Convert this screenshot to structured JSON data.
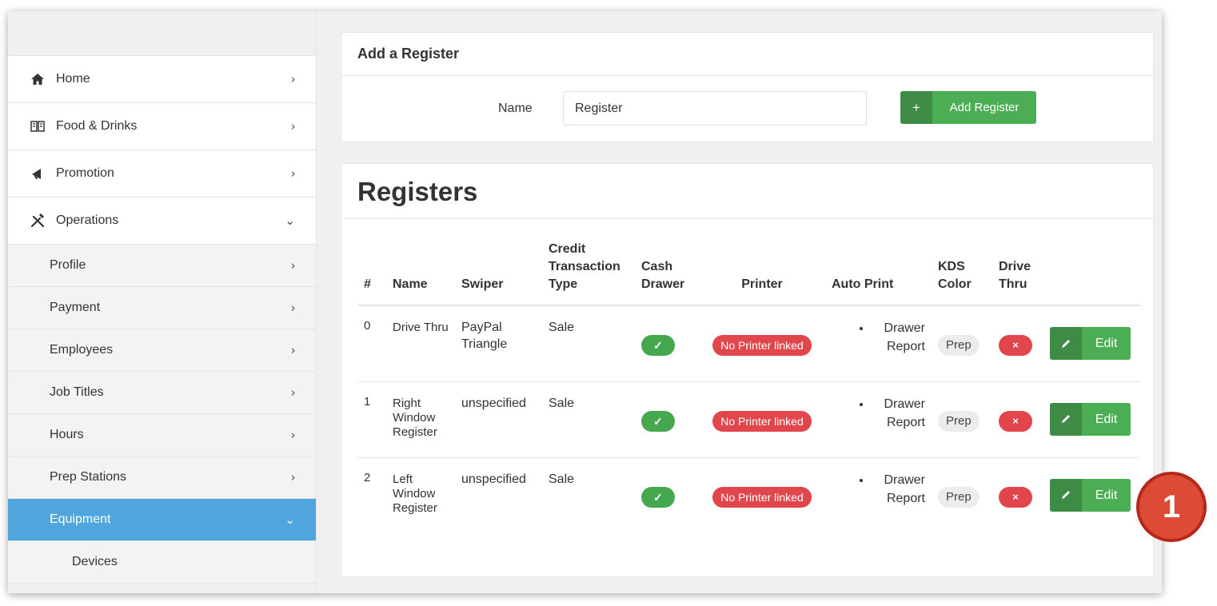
{
  "sidebar": {
    "items": [
      {
        "label": "Home",
        "icon": "home-icon",
        "chevron": "›"
      },
      {
        "label": "Food & Drinks",
        "icon": "menu-book-icon",
        "chevron": "›"
      },
      {
        "label": "Promotion",
        "icon": "megaphone-icon",
        "chevron": "›"
      },
      {
        "label": "Operations",
        "icon": "tools-icon",
        "chevron": "⌄"
      }
    ],
    "sub_items": [
      {
        "label": "Profile",
        "chevron": "›"
      },
      {
        "label": "Payment",
        "chevron": "›"
      },
      {
        "label": "Employees",
        "chevron": "›"
      },
      {
        "label": "Job Titles",
        "chevron": "›"
      },
      {
        "label": "Hours",
        "chevron": "›"
      },
      {
        "label": "Prep Stations",
        "chevron": "›"
      },
      {
        "label": "Equipment",
        "chevron": "⌄"
      }
    ],
    "subsub_items": [
      {
        "label": "Devices"
      }
    ]
  },
  "add_register": {
    "title": "Add a Register",
    "name_label": "Name",
    "name_value": "Register",
    "button_icon": "+",
    "button_label": "Add Register"
  },
  "registers": {
    "title": "Registers",
    "columns": [
      "#",
      "Name",
      "Swiper",
      "Credit Transaction Type",
      "Cash Drawer",
      "Printer",
      "Auto Print",
      "KDS Color",
      "Drive Thru"
    ],
    "rows": [
      {
        "num": "0",
        "name": "Drive Thru",
        "swiper": "PayPal Triangle",
        "type": "Sale",
        "cash": "✓",
        "printer": "No Printer linked",
        "auto_print": "Drawer Report",
        "kds": "Prep",
        "drive": "×",
        "edit": "Edit"
      },
      {
        "num": "1",
        "name": "Right Window Register",
        "swiper": "unspecified",
        "type": "Sale",
        "cash": "✓",
        "printer": "No Printer linked",
        "auto_print": "Drawer Report",
        "kds": "Prep",
        "drive": "×",
        "edit": "Edit"
      },
      {
        "num": "2",
        "name": "Left Window Register",
        "swiper": "unspecified",
        "type": "Sale",
        "cash": "✓",
        "printer": "No Printer linked",
        "auto_print": "Drawer Report",
        "kds": "Prep",
        "drive": "×",
        "edit": "Edit"
      }
    ]
  },
  "callout": {
    "number": "1"
  },
  "colors": {
    "active": "#4ea6dc",
    "success": "#4cae54",
    "success_dark": "#3d8b45",
    "danger": "#e0464b",
    "callout": "#dd4a35"
  }
}
